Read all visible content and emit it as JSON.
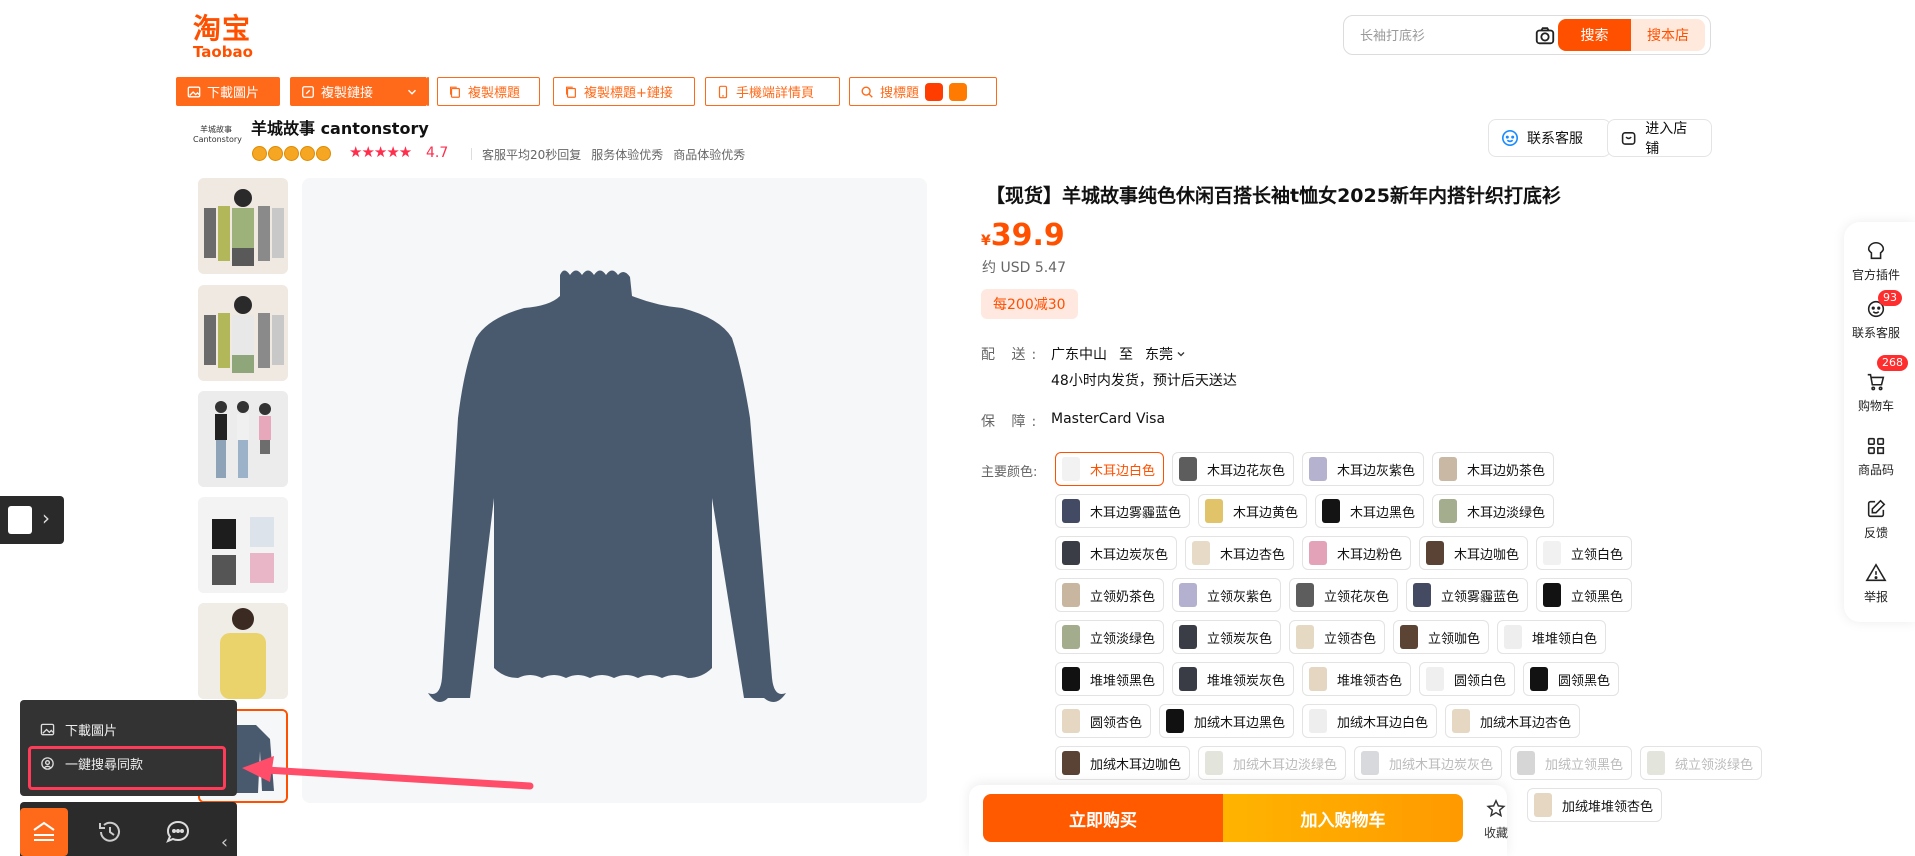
{
  "header": {
    "logo_cn": "淘宝",
    "logo_en": "Taobao",
    "search_placeholder": "长袖打底衫",
    "search_button": "搜索",
    "search_store_button": "搜本店"
  },
  "toolbar": {
    "download_images": "下載圖片",
    "copy_link": "複製鏈接",
    "copy_title": "複製標題",
    "copy_title_link": "複製標題+鏈接",
    "mobile_details": "手機端詳情頁",
    "search_title": "搜標題"
  },
  "store": {
    "logo_text": "羊城故事 Cantonstory",
    "name": "羊城故事 cantonstory",
    "stars": "★★★★★",
    "rating": "4.7",
    "meta": [
      "客服平均20秒回复",
      "服务体验优秀",
      "商品体验优秀"
    ],
    "contact_service": "联系客服",
    "enter_store": "进入店铺"
  },
  "product": {
    "title": "【现货】羊城故事纯色休闲百搭长袖t恤女2025新年内搭针织打底衫",
    "price_currency": "¥",
    "price": "39.9",
    "usd": "约 USD 5.47",
    "coupon": "每200减30",
    "delivery_label": "配 送:",
    "delivery_from": "广东中山",
    "delivery_to_word": "至",
    "delivery_to": "东莞",
    "delivery_note": "48小时内发货，预计后天送达",
    "guarantee_label": "保 障:",
    "guarantee_value": "MasterCard Visa",
    "color_label": "主要颜色:"
  },
  "colors": [
    {
      "label": "木耳边白色",
      "swatch": "#f2f2f2",
      "state": "selected"
    },
    {
      "label": "木耳边花灰色",
      "swatch": "#5d5d5d",
      "state": "normal"
    },
    {
      "label": "木耳边灰紫色",
      "swatch": "#b5b2cf",
      "state": "normal"
    },
    {
      "label": "木耳边奶茶色",
      "swatch": "#c9b8a3",
      "state": "normal"
    },
    {
      "label": "木耳边雾霾蓝色",
      "swatch": "#434a63",
      "state": "normal"
    },
    {
      "label": "木耳边黄色",
      "swatch": "#e1c36a",
      "state": "normal"
    },
    {
      "label": "木耳边黑色",
      "swatch": "#141414",
      "state": "normal"
    },
    {
      "label": "木耳边淡绿色",
      "swatch": "#a4ad8e",
      "state": "normal"
    },
    {
      "label": "木耳边炭灰色",
      "swatch": "#3b3d46",
      "state": "normal"
    },
    {
      "label": "木耳边杏色",
      "swatch": "#e7dac6",
      "state": "normal"
    },
    {
      "label": "木耳边粉色",
      "swatch": "#e4a2b8",
      "state": "normal"
    },
    {
      "label": "木耳边咖色",
      "swatch": "#5a4334",
      "state": "normal"
    },
    {
      "label": "立领白色",
      "swatch": "#f1f1f1",
      "state": "normal"
    },
    {
      "label": "立领奶茶色",
      "swatch": "#c8b6a0",
      "state": "normal"
    },
    {
      "label": "立领灰紫色",
      "swatch": "#b4b1d0",
      "state": "normal"
    },
    {
      "label": "立领花灰色",
      "swatch": "#5d5d5d",
      "state": "normal"
    },
    {
      "label": "立领雾霾蓝色",
      "swatch": "#444a62",
      "state": "normal"
    },
    {
      "label": "立领黑色",
      "swatch": "#121212",
      "state": "normal"
    },
    {
      "label": "立领淡绿色",
      "swatch": "#a3ad8d",
      "state": "normal"
    },
    {
      "label": "立领炭灰色",
      "swatch": "#3b3d46",
      "state": "normal"
    },
    {
      "label": "立领杏色",
      "swatch": "#e6d9c4",
      "state": "normal"
    },
    {
      "label": "立领咖色",
      "swatch": "#5b4434",
      "state": "normal"
    },
    {
      "label": "堆堆领白色",
      "swatch": "#eeeeee",
      "state": "normal"
    },
    {
      "label": "堆堆领黑色",
      "swatch": "#111111",
      "state": "normal"
    },
    {
      "label": "堆堆领炭灰色",
      "swatch": "#3a3c45",
      "state": "normal"
    },
    {
      "label": "堆堆领杏色",
      "swatch": "#e4d6c0",
      "state": "normal"
    },
    {
      "label": "圆领白色",
      "swatch": "#efefef",
      "state": "normal"
    },
    {
      "label": "圆领黑色",
      "swatch": "#121212",
      "state": "normal"
    },
    {
      "label": "圆领杏色",
      "swatch": "#e5d7c2",
      "state": "normal"
    },
    {
      "label": "加绒木耳边黑色",
      "swatch": "#111111",
      "state": "normal"
    },
    {
      "label": "加绒木耳边白色",
      "swatch": "#eeeeee",
      "state": "normal"
    },
    {
      "label": "加绒木耳边杏色",
      "swatch": "#e5d7c2",
      "state": "normal"
    },
    {
      "label": "加绒木耳边咖色",
      "swatch": "#5a4334",
      "state": "normal"
    },
    {
      "label": "加绒木耳边淡绿色",
      "swatch": "#e3e4dc",
      "state": "disabled"
    },
    {
      "label": "加绒木耳边炭灰色",
      "swatch": "#d8d9dc",
      "state": "disabled"
    },
    {
      "label": "加绒立领黑色",
      "swatch": "#d6d6d6",
      "state": "disabled"
    },
    {
      "label": "绒立领淡绿色",
      "swatch": "#e3e4dc",
      "state": "disabled"
    },
    {
      "label": "加绒堆堆领杏色",
      "swatch": "#e5d7c2",
      "state": "normal"
    }
  ],
  "buy_bar": {
    "buy_now": "立即购买",
    "add_to_cart": "加入购物车",
    "favorite": "收藏"
  },
  "right_rail": {
    "items": [
      "官方插件",
      "联系客服",
      "购物车",
      "商品码",
      "反馈",
      "举报"
    ],
    "service_badge": "93",
    "cart_badge": "268"
  },
  "plugin_menu": {
    "download_images": "下載圖片",
    "search_same": "一鍵搜尋同款"
  },
  "colors_theme": {
    "brand": "#ff5000",
    "toolbar": "#ff6a1a",
    "highlight": "#ff3b58"
  }
}
